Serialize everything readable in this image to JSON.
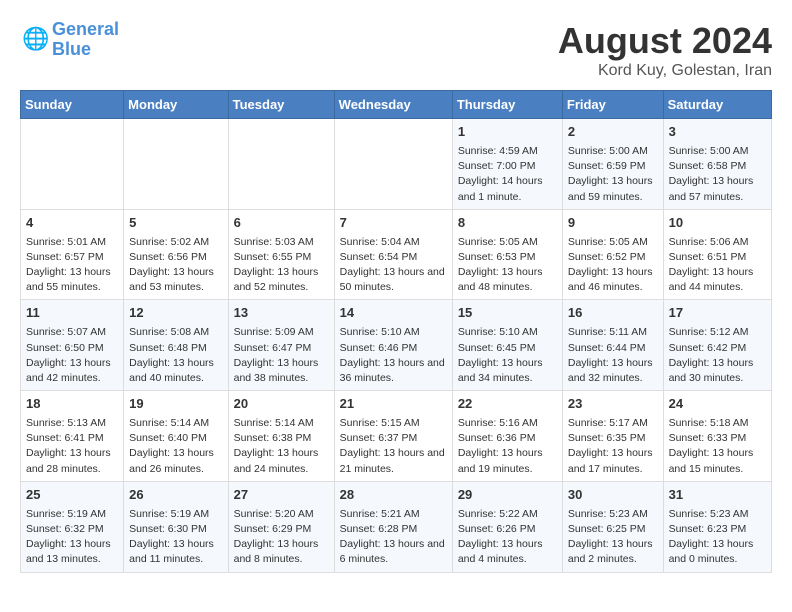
{
  "header": {
    "logo_line1": "General",
    "logo_line2": "Blue",
    "title": "August 2024",
    "subtitle": "Kord Kuy, Golestan, Iran"
  },
  "weekdays": [
    "Sunday",
    "Monday",
    "Tuesday",
    "Wednesday",
    "Thursday",
    "Friday",
    "Saturday"
  ],
  "weeks": [
    [
      {
        "day": "",
        "info": ""
      },
      {
        "day": "",
        "info": ""
      },
      {
        "day": "",
        "info": ""
      },
      {
        "day": "",
        "info": ""
      },
      {
        "day": "1",
        "info": "Sunrise: 4:59 AM\nSunset: 7:00 PM\nDaylight: 14 hours and 1 minute."
      },
      {
        "day": "2",
        "info": "Sunrise: 5:00 AM\nSunset: 6:59 PM\nDaylight: 13 hours and 59 minutes."
      },
      {
        "day": "3",
        "info": "Sunrise: 5:00 AM\nSunset: 6:58 PM\nDaylight: 13 hours and 57 minutes."
      }
    ],
    [
      {
        "day": "4",
        "info": "Sunrise: 5:01 AM\nSunset: 6:57 PM\nDaylight: 13 hours and 55 minutes."
      },
      {
        "day": "5",
        "info": "Sunrise: 5:02 AM\nSunset: 6:56 PM\nDaylight: 13 hours and 53 minutes."
      },
      {
        "day": "6",
        "info": "Sunrise: 5:03 AM\nSunset: 6:55 PM\nDaylight: 13 hours and 52 minutes."
      },
      {
        "day": "7",
        "info": "Sunrise: 5:04 AM\nSunset: 6:54 PM\nDaylight: 13 hours and 50 minutes."
      },
      {
        "day": "8",
        "info": "Sunrise: 5:05 AM\nSunset: 6:53 PM\nDaylight: 13 hours and 48 minutes."
      },
      {
        "day": "9",
        "info": "Sunrise: 5:05 AM\nSunset: 6:52 PM\nDaylight: 13 hours and 46 minutes."
      },
      {
        "day": "10",
        "info": "Sunrise: 5:06 AM\nSunset: 6:51 PM\nDaylight: 13 hours and 44 minutes."
      }
    ],
    [
      {
        "day": "11",
        "info": "Sunrise: 5:07 AM\nSunset: 6:50 PM\nDaylight: 13 hours and 42 minutes."
      },
      {
        "day": "12",
        "info": "Sunrise: 5:08 AM\nSunset: 6:48 PM\nDaylight: 13 hours and 40 minutes."
      },
      {
        "day": "13",
        "info": "Sunrise: 5:09 AM\nSunset: 6:47 PM\nDaylight: 13 hours and 38 minutes."
      },
      {
        "day": "14",
        "info": "Sunrise: 5:10 AM\nSunset: 6:46 PM\nDaylight: 13 hours and 36 minutes."
      },
      {
        "day": "15",
        "info": "Sunrise: 5:10 AM\nSunset: 6:45 PM\nDaylight: 13 hours and 34 minutes."
      },
      {
        "day": "16",
        "info": "Sunrise: 5:11 AM\nSunset: 6:44 PM\nDaylight: 13 hours and 32 minutes."
      },
      {
        "day": "17",
        "info": "Sunrise: 5:12 AM\nSunset: 6:42 PM\nDaylight: 13 hours and 30 minutes."
      }
    ],
    [
      {
        "day": "18",
        "info": "Sunrise: 5:13 AM\nSunset: 6:41 PM\nDaylight: 13 hours and 28 minutes."
      },
      {
        "day": "19",
        "info": "Sunrise: 5:14 AM\nSunset: 6:40 PM\nDaylight: 13 hours and 26 minutes."
      },
      {
        "day": "20",
        "info": "Sunrise: 5:14 AM\nSunset: 6:38 PM\nDaylight: 13 hours and 24 minutes."
      },
      {
        "day": "21",
        "info": "Sunrise: 5:15 AM\nSunset: 6:37 PM\nDaylight: 13 hours and 21 minutes."
      },
      {
        "day": "22",
        "info": "Sunrise: 5:16 AM\nSunset: 6:36 PM\nDaylight: 13 hours and 19 minutes."
      },
      {
        "day": "23",
        "info": "Sunrise: 5:17 AM\nSunset: 6:35 PM\nDaylight: 13 hours and 17 minutes."
      },
      {
        "day": "24",
        "info": "Sunrise: 5:18 AM\nSunset: 6:33 PM\nDaylight: 13 hours and 15 minutes."
      }
    ],
    [
      {
        "day": "25",
        "info": "Sunrise: 5:19 AM\nSunset: 6:32 PM\nDaylight: 13 hours and 13 minutes."
      },
      {
        "day": "26",
        "info": "Sunrise: 5:19 AM\nSunset: 6:30 PM\nDaylight: 13 hours and 11 minutes."
      },
      {
        "day": "27",
        "info": "Sunrise: 5:20 AM\nSunset: 6:29 PM\nDaylight: 13 hours and 8 minutes."
      },
      {
        "day": "28",
        "info": "Sunrise: 5:21 AM\nSunset: 6:28 PM\nDaylight: 13 hours and 6 minutes."
      },
      {
        "day": "29",
        "info": "Sunrise: 5:22 AM\nSunset: 6:26 PM\nDaylight: 13 hours and 4 minutes."
      },
      {
        "day": "30",
        "info": "Sunrise: 5:23 AM\nSunset: 6:25 PM\nDaylight: 13 hours and 2 minutes."
      },
      {
        "day": "31",
        "info": "Sunrise: 5:23 AM\nSunset: 6:23 PM\nDaylight: 13 hours and 0 minutes."
      }
    ]
  ]
}
